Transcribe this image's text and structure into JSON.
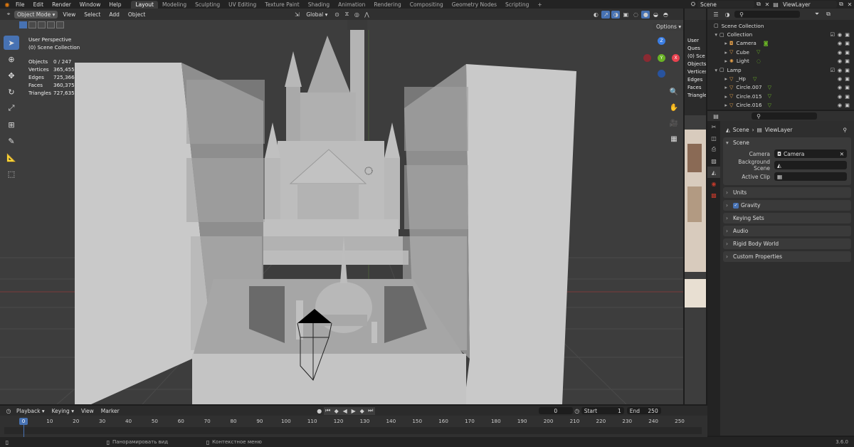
{
  "topbar": {
    "menus": [
      "File",
      "Edit",
      "Render",
      "Window",
      "Help"
    ],
    "workspaces": [
      "Layout",
      "Modeling",
      "Sculpting",
      "UV Editing",
      "Texture Paint",
      "Shading",
      "Animation",
      "Rendering",
      "Compositing",
      "Geometry Nodes",
      "Scripting"
    ],
    "active_workspace": "Layout",
    "add_tab": "+",
    "scene_label": "Scene",
    "viewlayer_label": "ViewLayer"
  },
  "viewport_header": {
    "mode": "Object Mode",
    "menus": [
      "View",
      "Select",
      "Add",
      "Object"
    ],
    "orientation": "Global",
    "options_label": "Options"
  },
  "viewport_overlay": {
    "perspective": "User Perspective",
    "collection": "(0) Scene Collection",
    "stats": [
      {
        "k": "Objects",
        "v": "0 / 247"
      },
      {
        "k": "Vertices",
        "v": "365,455"
      },
      {
        "k": "Edges",
        "v": "725,366"
      },
      {
        "k": "Faces",
        "v": "360,375"
      },
      {
        "k": "Triangles",
        "v": "727,635"
      }
    ]
  },
  "thin_panel": {
    "lines": [
      "User Ques",
      "(0) Sce",
      "Objects",
      "Vertices",
      "Edges",
      "Faces",
      "Triangle"
    ]
  },
  "outliner": {
    "rows": [
      {
        "name": "Scene Collection",
        "indent": 0,
        "icon": "collection-icon",
        "arrow": ""
      },
      {
        "name": "Collection",
        "indent": 1,
        "icon": "collection-icon",
        "arrow": "▾"
      },
      {
        "name": "Camera",
        "indent": 2,
        "icon": "camera-icon",
        "arrow": "▸"
      },
      {
        "name": "Cube",
        "indent": 2,
        "icon": "mesh-icon",
        "arrow": "▸"
      },
      {
        "name": "Light",
        "indent": 2,
        "icon": "light-icon",
        "arrow": "▸"
      },
      {
        "name": "Lamp",
        "indent": 1,
        "icon": "collection-icon",
        "arrow": "▾"
      },
      {
        "name": "_Hp",
        "indent": 2,
        "icon": "mesh-icon",
        "arrow": "▸"
      },
      {
        "name": "Circle.007",
        "indent": 2,
        "icon": "mesh-icon",
        "arrow": "▸"
      },
      {
        "name": "Circle.015",
        "indent": 2,
        "icon": "mesh-icon",
        "arrow": "▸"
      },
      {
        "name": "Circle.016",
        "indent": 2,
        "icon": "mesh-icon",
        "arrow": "▸"
      }
    ]
  },
  "properties": {
    "breadcrumb": [
      "Scene",
      "ViewLayer"
    ],
    "scene_panel": {
      "title": "Scene",
      "rows": [
        {
          "label": "Camera",
          "value": "Camera"
        },
        {
          "label": "Background Scene",
          "value": ""
        },
        {
          "label": "Active Clip",
          "value": ""
        }
      ]
    },
    "panels": [
      "Units",
      "Gravity",
      "Keying Sets",
      "Audio",
      "Rigid Body World",
      "Custom Properties"
    ],
    "gravity_checked": true
  },
  "timeline": {
    "menus": [
      "Playback",
      "Keying",
      "View",
      "Marker"
    ],
    "current_frame": "0",
    "start_label": "Start",
    "start": "1",
    "end_label": "End",
    "end": "250",
    "ticks": [
      "0",
      "10",
      "20",
      "30",
      "40",
      "50",
      "60",
      "70",
      "80",
      "90",
      "100",
      "110",
      "120",
      "130",
      "140",
      "150",
      "160",
      "170",
      "180",
      "190",
      "200",
      "210",
      "220",
      "230",
      "240",
      "250"
    ]
  },
  "status": {
    "pan_view": "Панорамировать вид",
    "context_menu": "Контекстное меню",
    "version": "3.6.0"
  },
  "colors": {
    "accent": "#4772b3",
    "x_axis": "#e8424f",
    "y_axis": "#6ab325",
    "z_axis": "#3b7ee3"
  }
}
